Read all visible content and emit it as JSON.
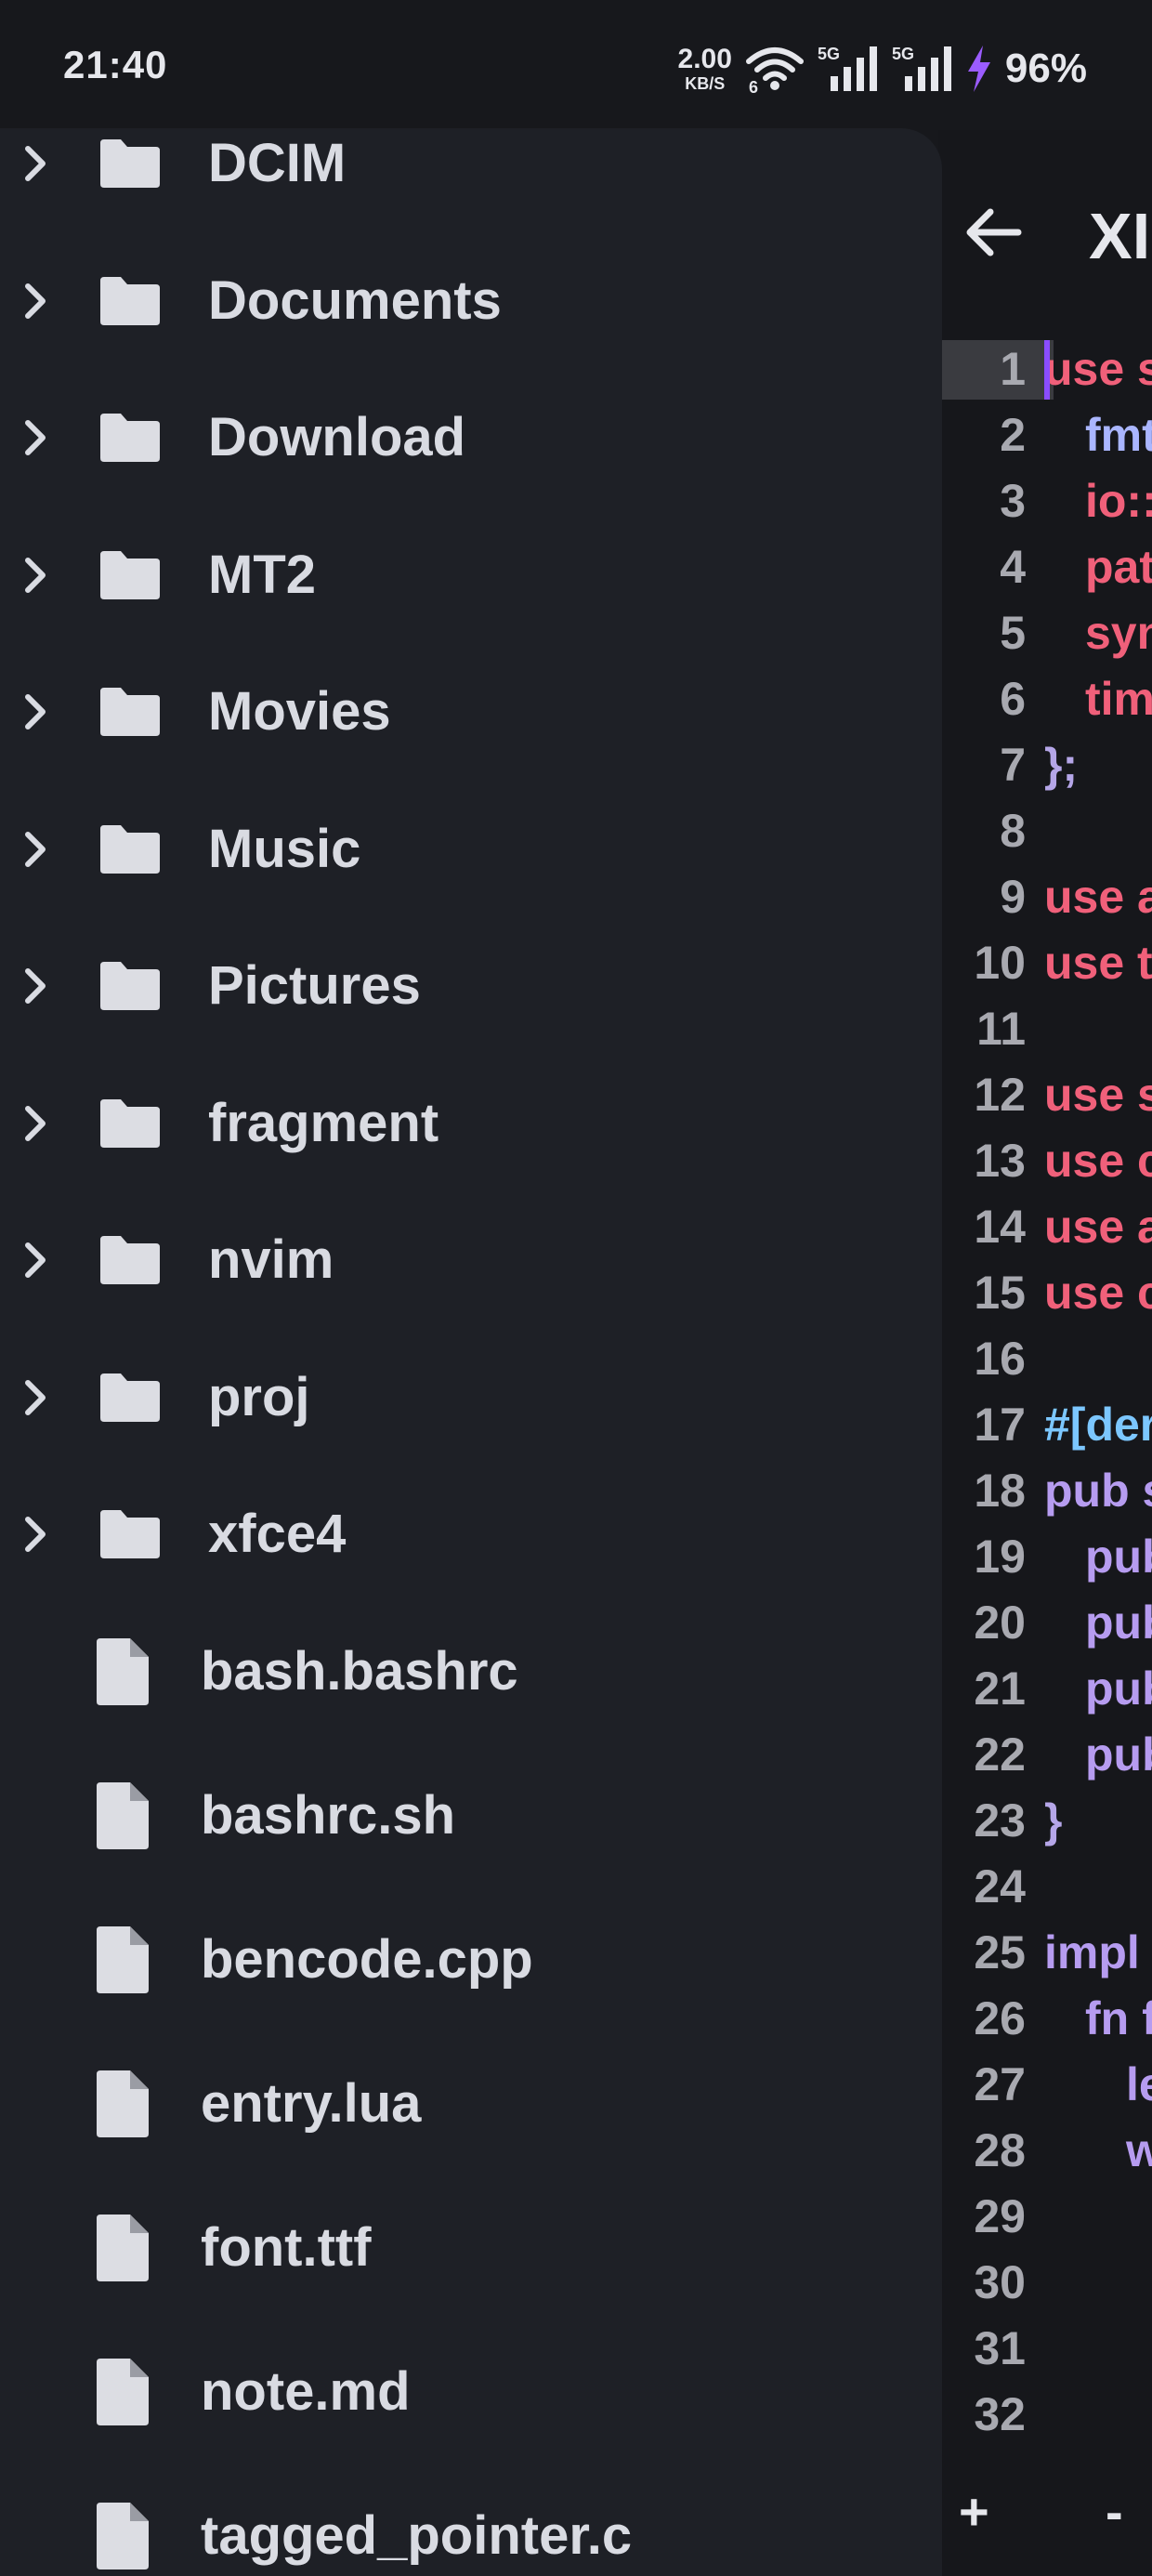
{
  "status_bar": {
    "time": "21:40",
    "net_speed_value": "2.00",
    "net_speed_unit": "KB/S",
    "wifi_sub": "6",
    "signal1_label": "5G",
    "signal2_label": "5G",
    "battery": "96%",
    "icons": [
      "wifi-icon",
      "signal-5g-icon",
      "signal-5g-icon",
      "charging-bolt-icon"
    ]
  },
  "drawer": {
    "items": [
      {
        "type": "folder",
        "name": "DCIM"
      },
      {
        "type": "folder",
        "name": "Documents"
      },
      {
        "type": "folder",
        "name": "Download"
      },
      {
        "type": "folder",
        "name": "MT2"
      },
      {
        "type": "folder",
        "name": "Movies"
      },
      {
        "type": "folder",
        "name": "Music"
      },
      {
        "type": "folder",
        "name": "Pictures"
      },
      {
        "type": "folder",
        "name": "fragment"
      },
      {
        "type": "folder",
        "name": "nvim"
      },
      {
        "type": "folder",
        "name": "proj"
      },
      {
        "type": "folder",
        "name": "xfce4"
      },
      {
        "type": "file",
        "name": "bash.bashrc"
      },
      {
        "type": "file",
        "name": "bashrc.sh"
      },
      {
        "type": "file",
        "name": "bencode.cpp"
      },
      {
        "type": "file",
        "name": "entry.lua"
      },
      {
        "type": "file",
        "name": "font.ttf"
      },
      {
        "type": "file",
        "name": "note.md"
      },
      {
        "type": "file",
        "name": "tagged_pointer.c"
      }
    ]
  },
  "editor": {
    "title": "XI",
    "active_line": 1,
    "toolbar": {
      "plus": "+",
      "minus": "-"
    },
    "colors": {
      "keyword_pink": "#f0607a",
      "keyword_purple": "#b69cf0",
      "field_blue": "#aab6ff",
      "attr_cyan": "#7cc7ff",
      "brace": "#b5a6e8",
      "cursor": "#8a4dff"
    },
    "lines": [
      {
        "n": "1",
        "text": "use s",
        "indent": 0,
        "color": "#f0607a"
      },
      {
        "n": "2",
        "text": "fmt",
        "indent": 1,
        "color": "#aab6ff"
      },
      {
        "n": "3",
        "text": "io::",
        "indent": 1,
        "color": "#f0607a"
      },
      {
        "n": "4",
        "text": "pat",
        "indent": 1,
        "color": "#f0607a"
      },
      {
        "n": "5",
        "text": "syn",
        "indent": 1,
        "color": "#f0607a"
      },
      {
        "n": "6",
        "text": "tim",
        "indent": 1,
        "color": "#f0607a"
      },
      {
        "n": "7",
        "text": "};",
        "indent": 0,
        "color": "#b5a6e8"
      },
      {
        "n": "8",
        "text": "",
        "indent": 0,
        "color": "#f0607a"
      },
      {
        "n": "9",
        "text": "use a",
        "indent": 0,
        "color": "#f0607a"
      },
      {
        "n": "10",
        "text": "use t",
        "indent": 0,
        "color": "#f0607a"
      },
      {
        "n": "11",
        "text": "",
        "indent": 0,
        "color": "#f0607a"
      },
      {
        "n": "12",
        "text": "use s",
        "indent": 0,
        "color": "#f0607a"
      },
      {
        "n": "13",
        "text": "use c",
        "indent": 0,
        "color": "#f0607a"
      },
      {
        "n": "14",
        "text": "use a",
        "indent": 0,
        "color": "#f0607a"
      },
      {
        "n": "15",
        "text": "use c",
        "indent": 0,
        "color": "#f0607a"
      },
      {
        "n": "16",
        "text": "",
        "indent": 0,
        "color": "#f0607a"
      },
      {
        "n": "17",
        "text": "#[der",
        "indent": 0,
        "color": "#7cc7ff"
      },
      {
        "n": "18",
        "text": "pub s",
        "indent": 0,
        "color": "#b69cf0"
      },
      {
        "n": "19",
        "text": "pub",
        "indent": 1,
        "color": "#b69cf0"
      },
      {
        "n": "20",
        "text": "pub",
        "indent": 1,
        "color": "#b69cf0"
      },
      {
        "n": "21",
        "text": "pub",
        "indent": 1,
        "color": "#b69cf0"
      },
      {
        "n": "22",
        "text": "pub",
        "indent": 1,
        "color": "#b69cf0"
      },
      {
        "n": "23",
        "text": "}",
        "indent": 0,
        "color": "#b5a6e8"
      },
      {
        "n": "24",
        "text": "",
        "indent": 0,
        "color": "#f0607a"
      },
      {
        "n": "25",
        "text": "impl f",
        "indent": 0,
        "color": "#b69cf0"
      },
      {
        "n": "26",
        "text": "fn f",
        "indent": 1,
        "color": "#b69cf0"
      },
      {
        "n": "27",
        "text": "le",
        "indent": 2,
        "color": "#b69cf0"
      },
      {
        "n": "28",
        "text": "w",
        "indent": 2,
        "color": "#b69cf0"
      },
      {
        "n": "29",
        "text": "",
        "indent": 0,
        "color": "#f0607a"
      },
      {
        "n": "30",
        "text": "",
        "indent": 0,
        "color": "#f0607a"
      },
      {
        "n": "31",
        "text": "",
        "indent": 0,
        "color": "#f0607a"
      },
      {
        "n": "32",
        "text": "",
        "indent": 0,
        "color": "#f0607a"
      }
    ]
  }
}
